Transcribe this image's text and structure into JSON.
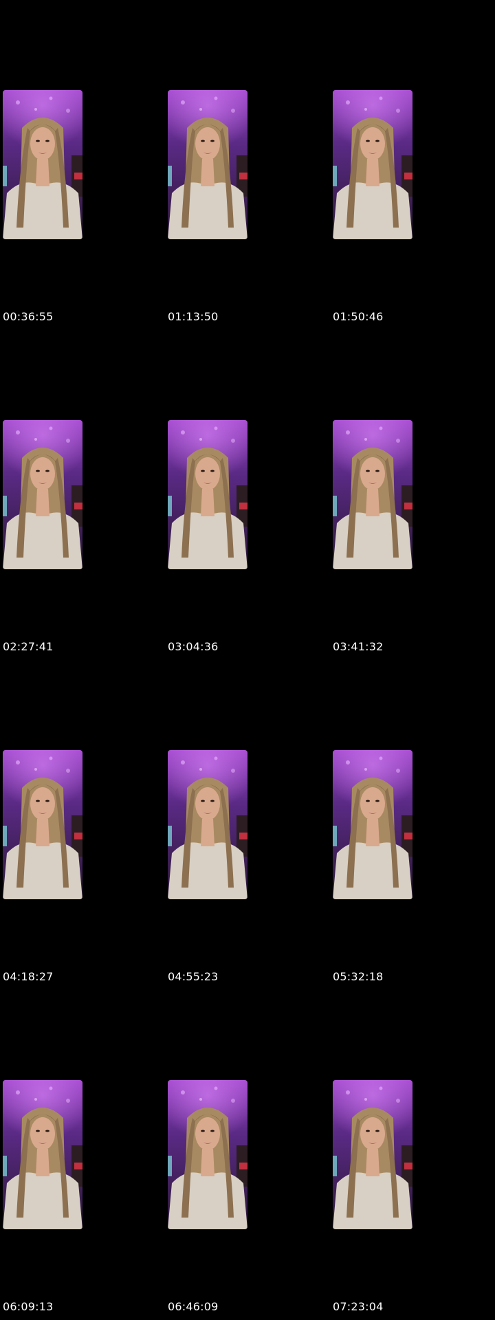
{
  "contact_sheet": {
    "frames": [
      {
        "timestamp": "00:36:55"
      },
      {
        "timestamp": "01:13:50"
      },
      {
        "timestamp": "01:50:46"
      },
      {
        "timestamp": "02:27:41"
      },
      {
        "timestamp": "03:04:36"
      },
      {
        "timestamp": "03:41:32"
      },
      {
        "timestamp": "04:18:27"
      },
      {
        "timestamp": "04:55:23"
      },
      {
        "timestamp": "05:32:18"
      },
      {
        "timestamp": "06:09:13"
      },
      {
        "timestamp": "06:46:09"
      },
      {
        "timestamp": "07:23:04"
      }
    ]
  },
  "colors": {
    "background": "#000000",
    "timestamp_text": "#ffffff",
    "backdrop_purple": "#5b2a86",
    "backdrop_magenta": "#a54bd0",
    "hair": "#a88a62",
    "skin": "#d9a98d",
    "top": "#d8d0c4"
  }
}
